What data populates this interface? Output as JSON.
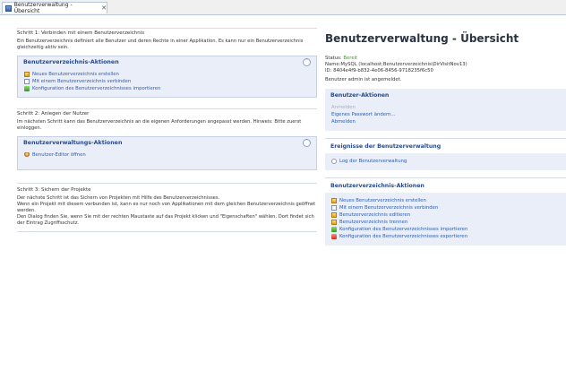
{
  "tab": {
    "label": "Benutzerverwaltung - Übersicht",
    "close": "✕"
  },
  "left": {
    "step1": {
      "title": "Schritt 1: Verbinden mit einem Benutzerverzeichnis",
      "text": "Ein Benutzerverzeichnis definiert alle Benutzer und deren Rechte in einer Applikation. Es kann nur ein Benutzerverzeichnis gleichzeitig aktiv sein.",
      "panel_title": "Benutzerverzeichnis-Aktionen",
      "actions": [
        "Neues Benutzerverzeichnis erstellen",
        "Mit einem Benutzerverzeichnis verbinden",
        "Konfiguration des Benutzerverzeichnisses importieren"
      ]
    },
    "step2": {
      "title": "Schritt 2: Anlegen der Nutzer",
      "text": "Im nächsten Schritt kann das Benutzerverzeichnis an die eigenen Anforderungen angepasst werden. Hinweis: Bitte zuerst einloggen.",
      "panel_title": "Benutzerverwaltungs-Aktionen",
      "actions": [
        "Benutzer-Editor öffnen"
      ]
    },
    "step3": {
      "title": "Schritt 3: Sichern der Projekte",
      "lines": [
        "Der nächste Schritt ist das Sichern von Projekten mit Hilfe des Benutzerverzeichnisses.",
        "Wenn ein Projekt mit diesem verbunden ist, kann es nur noch von Applikationen mit dem gleichen Benutzerverzeichnis geöffnet werden.",
        "Den Dialog finden Sie, wenn Sie mit der rechten Maustaste auf das Projekt klicken und \"Eigenschaften\" wählen. Dort findet sich der Eintrag Zugriffsschutz."
      ]
    }
  },
  "right": {
    "title": "Benutzerverwaltung - Übersicht",
    "status_label": "Status:",
    "status_value": "Bereit",
    "name_line": "Name:MySQL (localhost;Benutzerverzeichnis\\DirVisitNov13)",
    "id_line": "ID:    8404e4f9-b832-4e06-8456-9718235f6c50",
    "login_line": "Benutzer admin ist angemeldet.",
    "user_actions_title": "Benutzer-Aktionen",
    "user_actions": [
      {
        "label": "Anmelden",
        "enabled": false
      },
      {
        "label": "Eigenes Passwort ändern...",
        "enabled": true
      },
      {
        "label": "Abmelden",
        "enabled": true
      }
    ],
    "events_title": "Ereignisse der Benutzerverwaltung",
    "events_actions": [
      "Log der Benutzerverwaltung"
    ],
    "dir_actions_title": "Benutzerverzeichnis-Aktionen",
    "dir_actions": [
      "Neues Benutzerverzeichnis erstellen",
      "Mit einem Benutzerverzeichnis verbinden",
      "Benutzerverzeichnis editieren",
      "Benutzerverzeichnis trennen",
      "Konfiguration des Benutzerverzeichnisses importieren",
      "Konfiguration des Benutzerverzeichnisses exportieren"
    ]
  }
}
